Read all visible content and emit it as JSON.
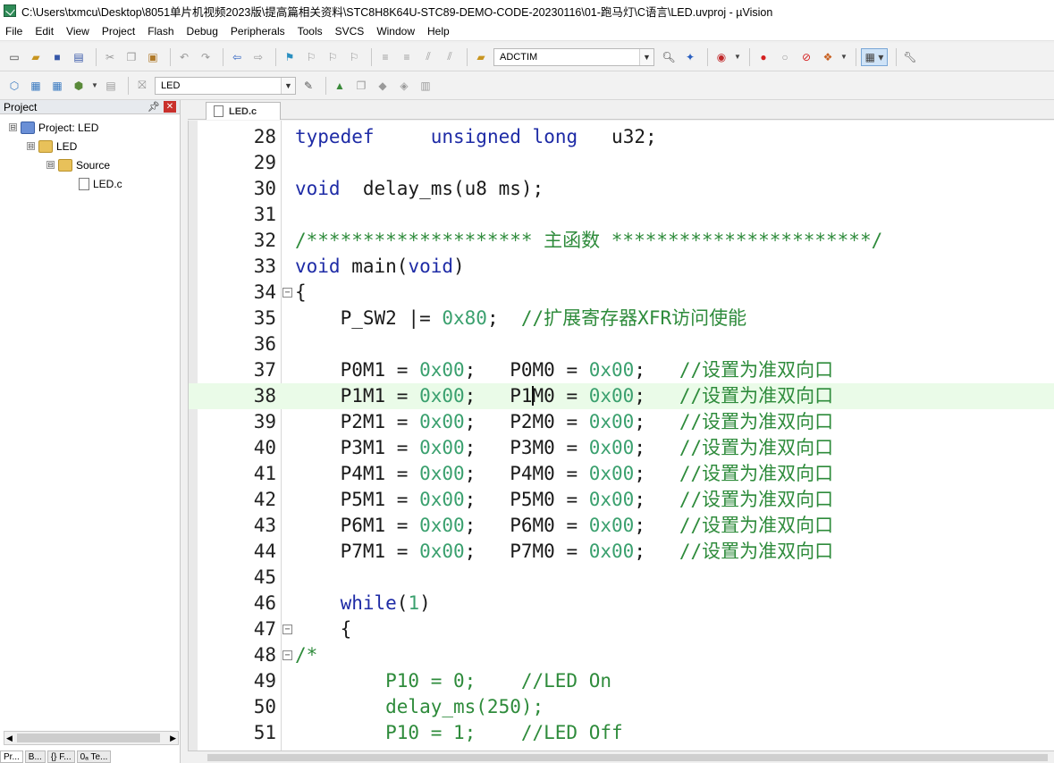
{
  "window": {
    "title": "C:\\Users\\txmcu\\Desktop\\8051单片机视频2023版\\提高篇相关资料\\STC8H8K64U-STC89-DEMO-CODE-20230116\\01-跑马灯\\C语言\\LED.uvproj - µVision"
  },
  "menu": [
    "File",
    "Edit",
    "View",
    "Project",
    "Flash",
    "Debug",
    "Peripherals",
    "Tools",
    "SVCS",
    "Window",
    "Help"
  ],
  "toolbar": {
    "find_combo_value": "ADCTIM",
    "target_combo_value": "LED"
  },
  "project_panel": {
    "title": "Project",
    "tree": [
      {
        "level": 0,
        "label": "Project: LED",
        "icon": "project-icon",
        "expander": "⊟"
      },
      {
        "level": 1,
        "label": "LED",
        "icon": "folder-icon",
        "expander": "⊟"
      },
      {
        "level": 2,
        "label": "Source",
        "icon": "folder-icon",
        "expander": "⊟"
      },
      {
        "level": 3,
        "label": "LED.c",
        "icon": "file-icon",
        "expander": ""
      }
    ],
    "bottom_tabs": [
      "Pr...",
      "B...",
      "{} F...",
      "0ₐ Te..."
    ]
  },
  "editor": {
    "tab_label": "LED.c",
    "highlighted_line": 38,
    "lines": [
      {
        "num": "28",
        "text": "typedef     unsigned long   u32;",
        "fold": ""
      },
      {
        "num": "29",
        "text": "",
        "fold": ""
      },
      {
        "num": "30",
        "text": "void  delay_ms(u8 ms);",
        "fold": ""
      },
      {
        "num": "31",
        "text": "",
        "fold": ""
      },
      {
        "num": "32",
        "text": "/******************** 主函数 ***********************/",
        "fold": ""
      },
      {
        "num": "33",
        "text": "void main(void)",
        "fold": ""
      },
      {
        "num": "34",
        "text": "{",
        "fold": "⊟"
      },
      {
        "num": "35",
        "text": "    P_SW2 |= 0x80;  //扩展寄存器XFR访问使能",
        "fold": ""
      },
      {
        "num": "36",
        "text": "",
        "fold": ""
      },
      {
        "num": "37",
        "text": "    P0M1 = 0x00;   P0M0 = 0x00;   //设置为准双向口",
        "fold": ""
      },
      {
        "num": "38",
        "text": "    P1M1 = 0x00;   P1M0 = 0x00;   //设置为准双向口",
        "fold": ""
      },
      {
        "num": "39",
        "text": "    P2M1 = 0x00;   P2M0 = 0x00;   //设置为准双向口",
        "fold": ""
      },
      {
        "num": "40",
        "text": "    P3M1 = 0x00;   P3M0 = 0x00;   //设置为准双向口",
        "fold": ""
      },
      {
        "num": "41",
        "text": "    P4M1 = 0x00;   P4M0 = 0x00;   //设置为准双向口",
        "fold": ""
      },
      {
        "num": "42",
        "text": "    P5M1 = 0x00;   P5M0 = 0x00;   //设置为准双向口",
        "fold": ""
      },
      {
        "num": "43",
        "text": "    P6M1 = 0x00;   P6M0 = 0x00;   //设置为准双向口",
        "fold": ""
      },
      {
        "num": "44",
        "text": "    P7M1 = 0x00;   P7M0 = 0x00;   //设置为准双向口",
        "fold": ""
      },
      {
        "num": "45",
        "text": "",
        "fold": ""
      },
      {
        "num": "46",
        "text": "    while(1)",
        "fold": ""
      },
      {
        "num": "47",
        "text": "    {",
        "fold": "⊟"
      },
      {
        "num": "48",
        "text": "/*",
        "fold": "⊟"
      },
      {
        "num": "49",
        "text": "        P10 = 0;    //LED On",
        "fold": ""
      },
      {
        "num": "50",
        "text": "        delay_ms(250);",
        "fold": ""
      },
      {
        "num": "51",
        "text": "        P10 = 1;    //LED Off",
        "fold": ""
      }
    ]
  }
}
